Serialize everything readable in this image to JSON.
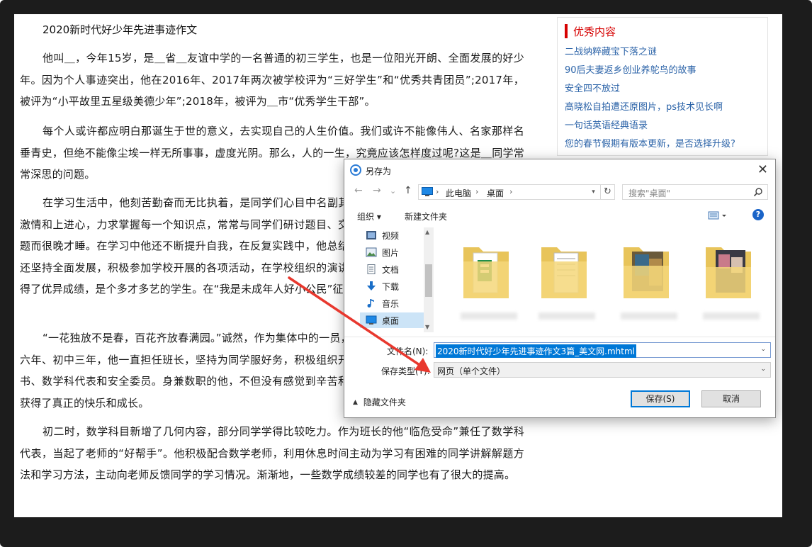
{
  "article": {
    "title": "2020新时代好少年先进事迹作文",
    "paragraphs": [
      "他叫＿，今年15岁，是＿省＿友谊中学的一名普通的初三学生，也是一位阳光开朗、全面发展的好少年。因为个人事迹突出，他在2016年、2017年两次被学校评为“三好学生”和“优秀共青团员”;2017年，被评为“小平故里五星级美德少年”;2018年，被评为＿市“优秀学生干部”。",
      "每个人或许都应明白那诞生于世的意义，去实现自己的人生价值。我们或许不能像伟人、名家那样名垂青史，但绝不能像尘埃一样无所事事，虚度光阴。那么，人的一生，究竟应该怎样度过呢?这是＿同学常常深思的问题。",
      "在学习生活中，他刻苦勤奋而无比执着，是同学们心目中名副其实的学霸。他的内心时时刻刻充满了激情和上进心，力求掌握每一个知识点，常常与同学们研讨题目、交流学习心得，有时甚至为解决一道难题而很晚才睡。在学习中他还不断提升自我，在反复实践中，他总结出了一整套行之有效的学习方法。他还坚持全面发展，积极参加学校开展的各项活动，在学校组织的演讲比赛、书法比还赛、征文比赛中都取得了优异成绩，是个多才多艺的学生。在“我是未成年人好小公民”征文活动中，他还获了省一等奖。",
      "“一花独放不是春，百花齐放春满园。”诚然，作为集体中的一员，他认为集体的荣誉是最重要的。小学六年、初中三年，他一直担任班长，坚持为同学服好务，积极组织开展各项班级活动，被选为班上的团支书、数学科代表和安全委员。身兼数职的他，不但没有感觉到辛苦和压力，反而在为同学们服务的过程中获得了真正的快乐和成长。",
      "初二时，数学科目新增了几何内容，部分同学学得比较吃力。作为班长的他“临危受命”兼任了数学科代表，当起了老师的“好帮手”。他积极配合数学老师，利用休息时间主动为学习有困难的同学讲解解题方法和学习方法，主动向老师反馈同学的学习情况。渐渐地，一些数学成绩较差的同学也有了很大的提高。"
    ]
  },
  "sidebar": {
    "title": "优秀内容",
    "items": [
      "二战纳粹藏宝下落之谜",
      "90后夫妻返乡创业养鸵鸟的故事",
      "安全四不放过",
      "高晓松自拍遭还原图片，ps技术见长啊",
      "一句话英语经典语录",
      "您的春节假期有版本更新，是否选择升级?"
    ]
  },
  "dialog": {
    "title": "另存为",
    "close": "✕",
    "nav": {
      "back": "←",
      "forward": "→",
      "recent": "⌄",
      "up": "↑"
    },
    "address": {
      "segments": [
        "此电脑",
        "桌面"
      ],
      "sep": "›"
    },
    "search_placeholder": "搜索\"桌面\"",
    "toolbar": {
      "organize": "组织 ▾",
      "new_folder": "新建文件夹",
      "help": "?"
    },
    "nav_items": [
      "视频",
      "图片",
      "文档",
      "下载",
      "音乐",
      "桌面"
    ],
    "file_name_label": "文件名(N):",
    "file_name_value": "2020新时代好少年先进事迹作文3篇_美文网.mhtml",
    "file_type_label": "保存类型(T):",
    "file_type_value": "网页（单个文件）",
    "hide_folders": "隐藏文件夹",
    "save_button": "保存(S)",
    "cancel_button": "取消"
  },
  "colors": {
    "accent_red": "#d60000",
    "link_blue": "#2b63a8",
    "selection_blue": "#0078d7",
    "annotation_arrow": "#e8382e"
  }
}
